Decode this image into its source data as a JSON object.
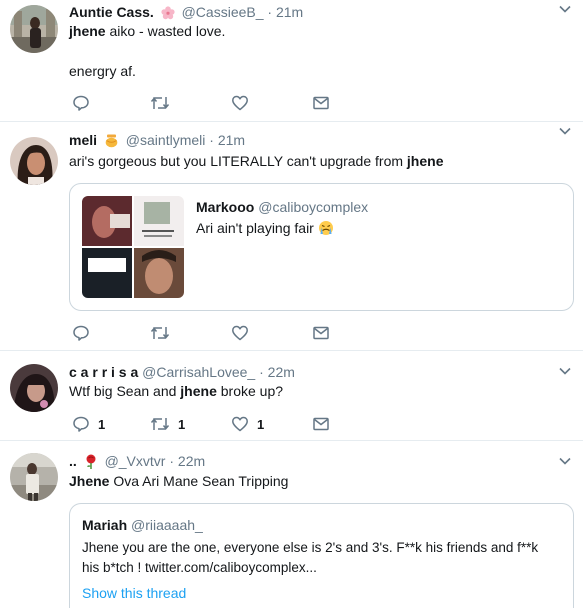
{
  "colors": {
    "text": "#14171a",
    "muted": "#657786",
    "border": "#e6ecf0",
    "quote_border": "#ccd6dd",
    "link": "#1da1f2"
  },
  "tweets": [
    {
      "name": "Auntie Cass.",
      "badge_icon": "cherry-blossom-icon",
      "handle": "@CassieeB_",
      "separator": "·",
      "time": "21m",
      "line1_bold": "jhene",
      "line1_rest": " aiko - wasted love.",
      "line2": "energry af.",
      "actions": {
        "reply": "",
        "retweet": "",
        "like": ""
      }
    },
    {
      "name": "meli",
      "badge_icon": "honey-pot-icon",
      "handle": "@saintlymeli",
      "separator": "·",
      "time": "21m",
      "text_plain": "ari's gorgeous but you LITERALLY can't upgrade from ",
      "text_bold": "jhene",
      "quote": {
        "name": "Markooo",
        "handle": "@caliboycomplex",
        "text": "Ari ain't playing fair",
        "emoji_icon": "crying-face-icon"
      },
      "actions": {
        "reply": "",
        "retweet": "",
        "like": ""
      }
    },
    {
      "name": "c a r r i s a",
      "handle": "@CarrisahLovee_",
      "separator": "·",
      "time": "22m",
      "text_plain": "Wtf big Sean and ",
      "text_bold": "jhene",
      "text_after": " broke up?",
      "actions": {
        "reply": "1",
        "retweet": "1",
        "like": "1"
      }
    },
    {
      "name": "..",
      "badge_icon": "rose-icon",
      "handle": "@_Vxvtvr",
      "separator": "·",
      "time": "22m",
      "text_bold": "Jhene",
      "text_plain": " Ova Ari Mane Sean Tripping",
      "quote": {
        "name": "Mariah",
        "handle": "@riiaaaah_",
        "line1": "Jhene you are the one, everyone else is 2's and 3's. F**k his friends and f**k",
        "line2": "his b*tch ! twitter.com/caliboycomplex...",
        "show_thread": "Show this thread"
      }
    }
  ]
}
